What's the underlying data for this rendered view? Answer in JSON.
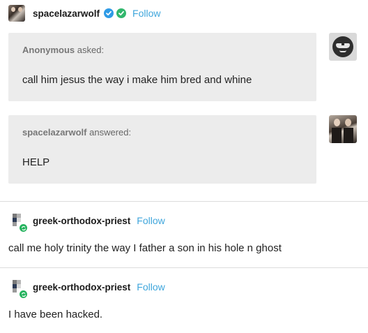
{
  "post": {
    "author": "spacelazarwolf",
    "follow_label": "Follow"
  },
  "ask": {
    "asker": "Anonymous",
    "asked_label": "asked:",
    "question": "call him jesus the way i make him bred and whine"
  },
  "answer": {
    "answerer": "spacelazarwolf",
    "answered_label": "answered:",
    "text": "HELP"
  },
  "reblogs": [
    {
      "username": "greek-orthodox-priest",
      "follow_label": "Follow",
      "text": "call me holy trinity the way I father a son in his hole n ghost"
    },
    {
      "username": "greek-orthodox-priest",
      "follow_label": "Follow",
      "text": "I have been hacked."
    }
  ],
  "colors": {
    "follow": "#3fa6dc",
    "bubble": "#ececec",
    "verified_blue": "#2f9be6",
    "verified_green": "#31b76d",
    "reblog_green": "#25b35e"
  }
}
